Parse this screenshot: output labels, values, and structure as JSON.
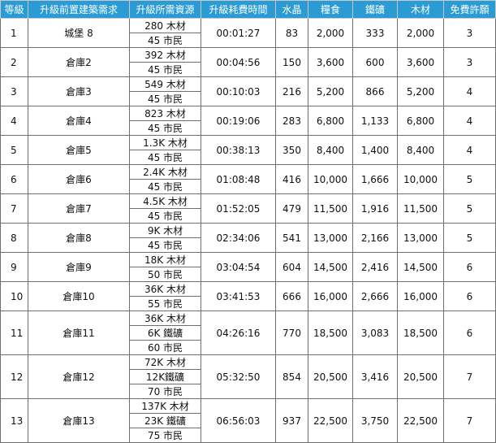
{
  "headers": [
    "等級",
    "升級前置建築需求",
    "升級所需資源",
    "升級耗費時間",
    "水晶",
    "糧食",
    "鐵礦",
    "木材",
    "免費許願"
  ],
  "rows": [
    {
      "level": "1",
      "building": "城堡 8",
      "resources": [
        "280 木材",
        "45 市民"
      ],
      "time": "00:01:27",
      "crystal": "83",
      "food": "2,000",
      "iron": "333",
      "wood": "2,000",
      "wishes": "3"
    },
    {
      "level": "2",
      "building": "倉庫2",
      "resources": [
        "392 木材",
        "45 市民"
      ],
      "time": "00:04:56",
      "crystal": "150",
      "food": "3,600",
      "iron": "600",
      "wood": "3,600",
      "wishes": "3"
    },
    {
      "level": "3",
      "building": "倉庫3",
      "resources": [
        "549 木材",
        "45 市民"
      ],
      "time": "00:10:03",
      "crystal": "216",
      "food": "5,200",
      "iron": "866",
      "wood": "5,200",
      "wishes": "4"
    },
    {
      "level": "4",
      "building": "倉庫4",
      "resources": [
        "823 木材",
        "45 市民"
      ],
      "time": "00:19:06",
      "crystal": "283",
      "food": "6,800",
      "iron": "1,133",
      "wood": "6,800",
      "wishes": "4"
    },
    {
      "level": "5",
      "building": "倉庫5",
      "resources": [
        "1.3K 木材",
        "45 市民"
      ],
      "time": "00:38:13",
      "crystal": "350",
      "food": "8,400",
      "iron": "1,400",
      "wood": "8,400",
      "wishes": "4"
    },
    {
      "level": "6",
      "building": "倉庫6",
      "resources": [
        "2.4K 木材",
        "45 市民"
      ],
      "time": "01:08:48",
      "crystal": "416",
      "food": "10,000",
      "iron": "1,666",
      "wood": "10,000",
      "wishes": "5"
    },
    {
      "level": "7",
      "building": "倉庫7",
      "resources": [
        "4.5K 木材",
        "45 市民"
      ],
      "time": "01:52:05",
      "crystal": "479",
      "food": "11,500",
      "iron": "1,916",
      "wood": "11,500",
      "wishes": "5"
    },
    {
      "level": "8",
      "building": "倉庫8",
      "resources": [
        "9K 木材",
        "45 市民"
      ],
      "time": "02:34:06",
      "crystal": "541",
      "food": "13,000",
      "iron": "2,166",
      "wood": "13,000",
      "wishes": "5"
    },
    {
      "level": "9",
      "building": "倉庫9",
      "resources": [
        "18K 木材",
        "50 市民"
      ],
      "time": "03:04:54",
      "crystal": "604",
      "food": "14,500",
      "iron": "2,416",
      "wood": "14,500",
      "wishes": "6"
    },
    {
      "level": "10",
      "building": "倉庫10",
      "resources": [
        "36K 木材",
        "55 市民"
      ],
      "time": "03:41:53",
      "crystal": "666",
      "food": "16,000",
      "iron": "2,666",
      "wood": "16,000",
      "wishes": "6"
    },
    {
      "level": "11",
      "building": "倉庫11",
      "resources": [
        "36K 木材",
        "6K 鐵礦",
        "60 市民"
      ],
      "time": "04:26:16",
      "crystal": "770",
      "food": "18,500",
      "iron": "3,083",
      "wood": "18,500",
      "wishes": "6"
    },
    {
      "level": "12",
      "building": "倉庫12",
      "resources": [
        "72K 木材",
        "12K鐵礦",
        "70 市民"
      ],
      "time": "05:32:50",
      "crystal": "854",
      "food": "20,500",
      "iron": "3,416",
      "wood": "20,500",
      "wishes": "7"
    },
    {
      "level": "13",
      "building": "倉庫13",
      "resources": [
        "137K 木材",
        "23K 鐵礦",
        "75 市民"
      ],
      "time": "06:56:03",
      "crystal": "937",
      "food": "22,500",
      "iron": "3,750",
      "wood": "22,500",
      "wishes": "7"
    }
  ]
}
